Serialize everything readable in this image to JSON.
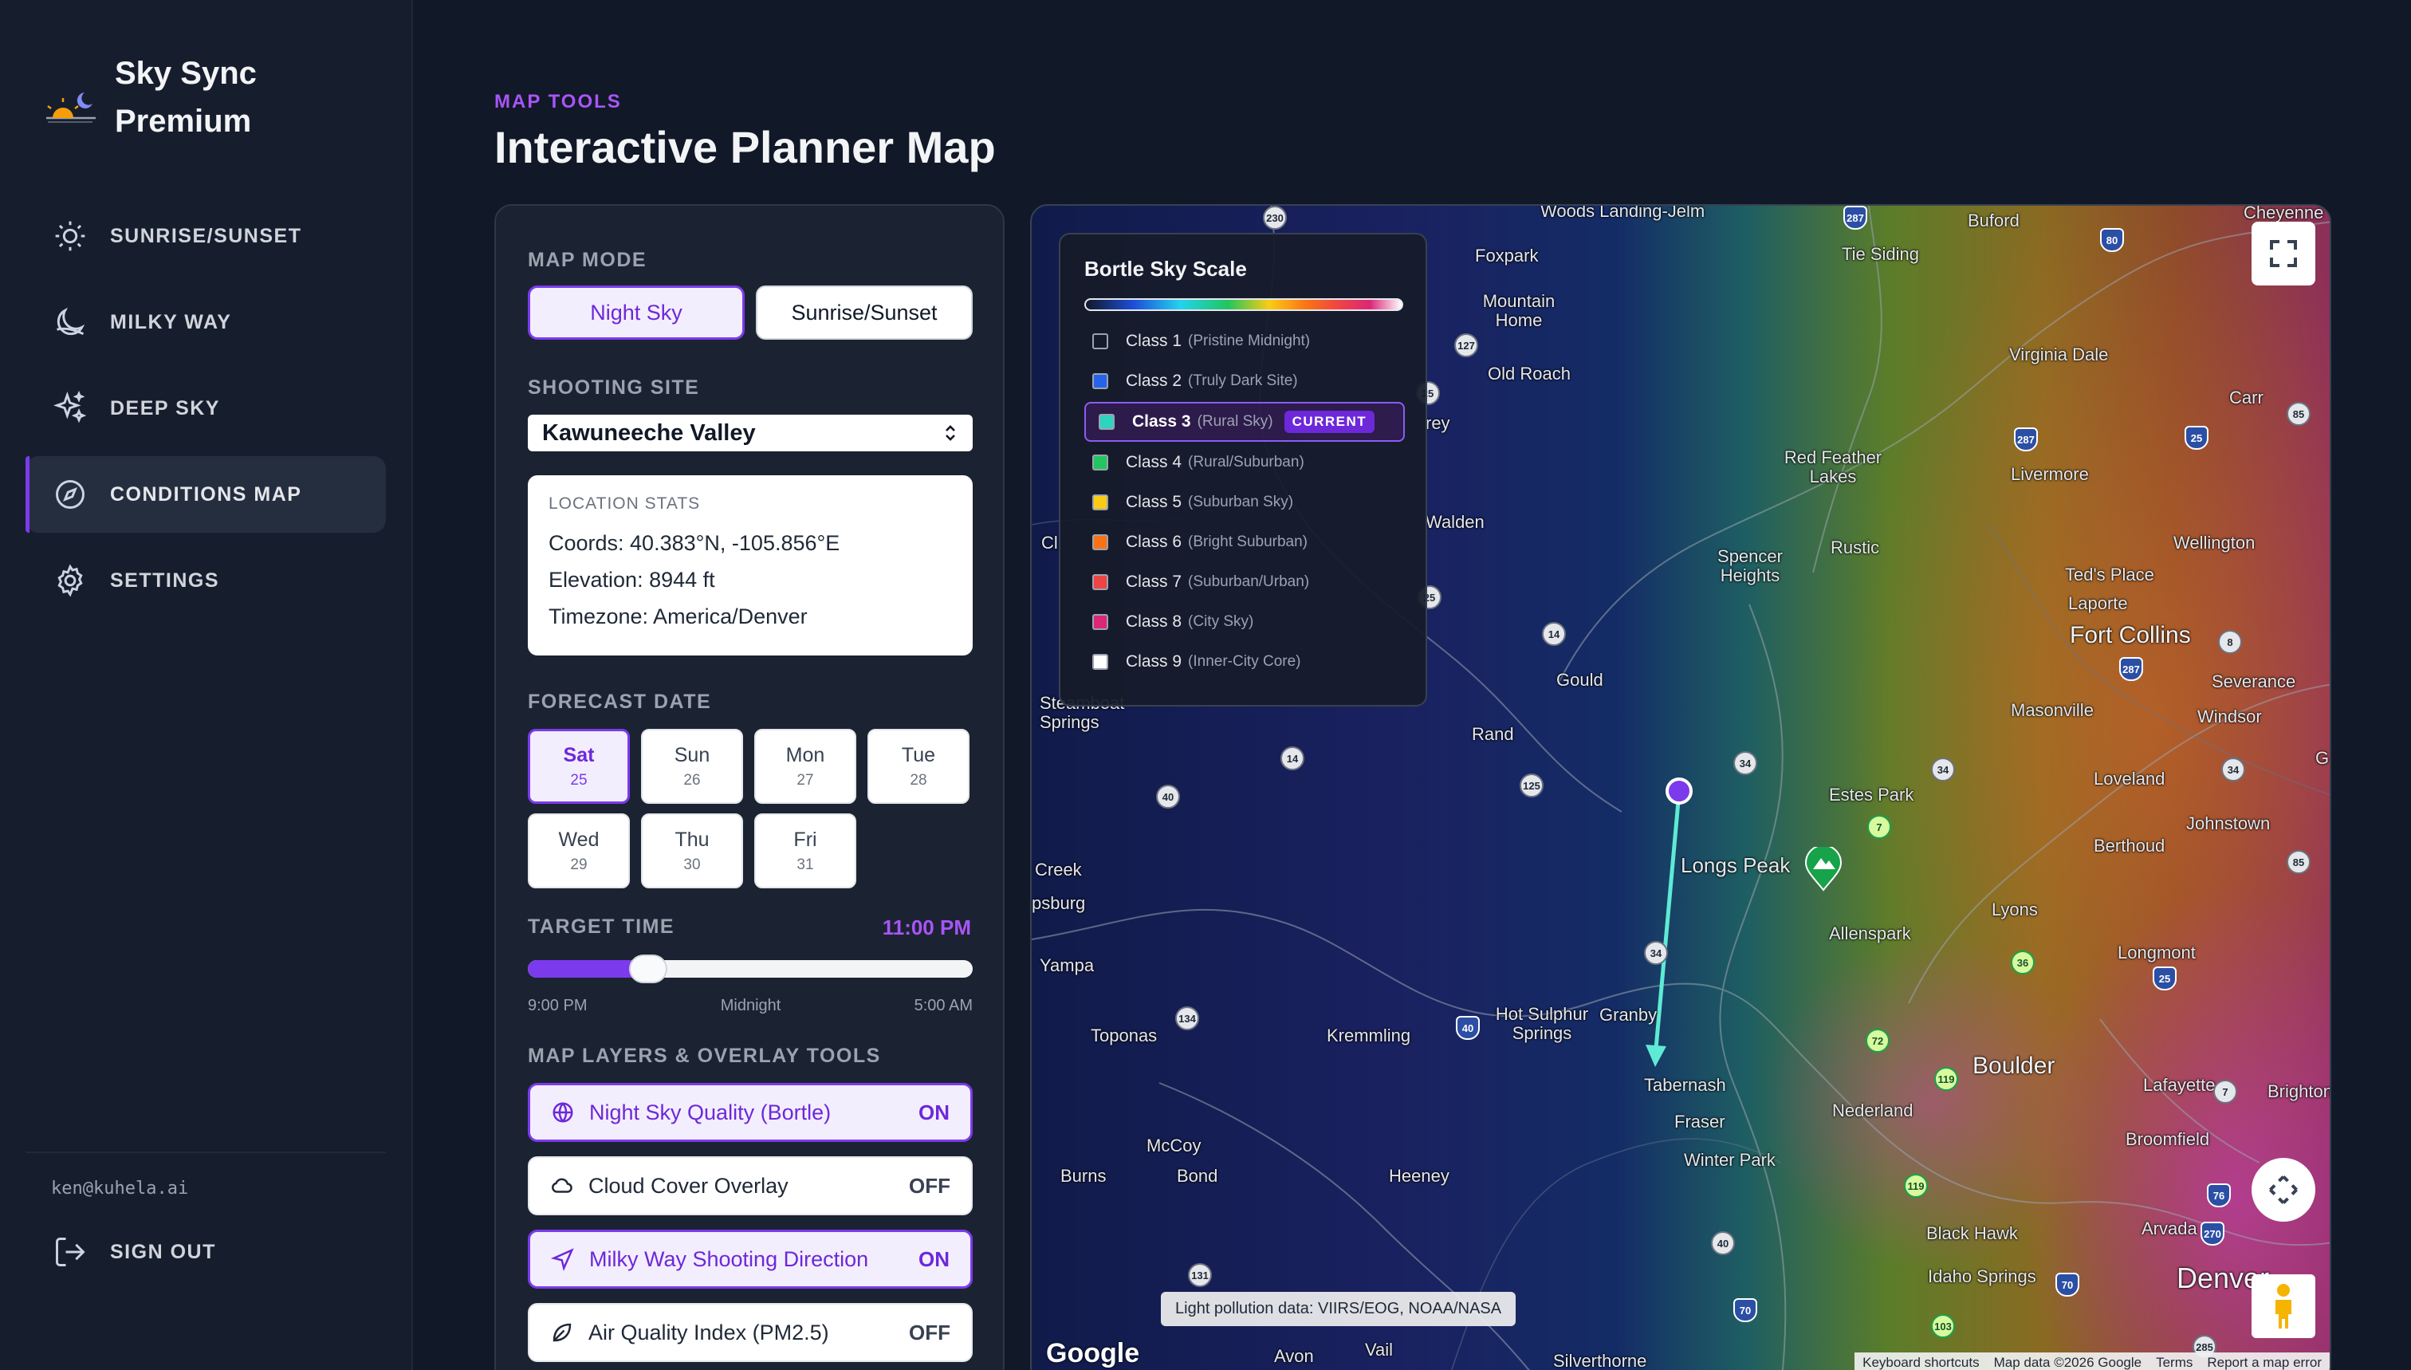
{
  "app": {
    "name": "Sky Sync Premium"
  },
  "sidebar": {
    "items": [
      {
        "label": "SUNRISE/SUNSET",
        "icon": "sun-icon"
      },
      {
        "label": "MILKY WAY",
        "icon": "moon-icon"
      },
      {
        "label": "DEEP SKY",
        "icon": "sparkles-icon"
      },
      {
        "label": "CONDITIONS MAP",
        "icon": "compass-icon",
        "active": true
      },
      {
        "label": "SETTINGS",
        "icon": "gear-icon"
      }
    ],
    "user_email": "ken@kuhela.ai",
    "sign_out": "SIGN OUT"
  },
  "header": {
    "eyebrow": "MAP TOOLS",
    "title": "Interactive Planner Map"
  },
  "panel": {
    "map_mode": {
      "label": "MAP MODE",
      "options": [
        "Night Sky",
        "Sunrise/Sunset"
      ],
      "selected": "Night Sky"
    },
    "shooting_site": {
      "label": "SHOOTING SITE",
      "value": "Kawuneeche Valley"
    },
    "location_stats": {
      "caption": "LOCATION STATS",
      "coords": "Coords: 40.383°N, -105.856°E",
      "elevation": "Elevation: 8944 ft",
      "timezone": "Timezone: America/Denver"
    },
    "forecast": {
      "label": "FORECAST DATE",
      "days": [
        {
          "name": "Sat",
          "date": "25",
          "active": true
        },
        {
          "name": "Sun",
          "date": "26"
        },
        {
          "name": "Mon",
          "date": "27"
        },
        {
          "name": "Tue",
          "date": "28"
        },
        {
          "name": "Wed",
          "date": "29"
        },
        {
          "name": "Thu",
          "date": "30"
        },
        {
          "name": "Fri",
          "date": "31"
        }
      ]
    },
    "target_time": {
      "label": "TARGET TIME",
      "value": "11:00 PM",
      "slider_fraction": 0.27,
      "ticks": [
        "9:00 PM",
        "Midnight",
        "5:00 AM"
      ]
    },
    "layers": {
      "label": "MAP LAYERS & OVERLAY TOOLS",
      "items": [
        {
          "label": "Night Sky Quality (Bortle)",
          "state": "ON",
          "icon": "globe-icon"
        },
        {
          "label": "Cloud Cover Overlay",
          "state": "OFF",
          "icon": "cloud-icon"
        },
        {
          "label": "Milky Way Shooting Direction",
          "state": "ON",
          "icon": "navigation-arrow-icon"
        },
        {
          "label": "Air Quality Index (PM2.5)",
          "state": "OFF",
          "icon": "leaf-icon"
        }
      ]
    }
  },
  "map": {
    "legend": {
      "title": "Bortle Sky Scale",
      "current_badge": "CURRENT",
      "classes": [
        {
          "label": "Class 1",
          "desc": "(Pristine Midnight)",
          "color": "#111827"
        },
        {
          "label": "Class 2",
          "desc": "(Truly Dark Site)",
          "color": "#2563eb"
        },
        {
          "label": "Class 3",
          "desc": "(Rural Sky)",
          "color": "#2dd4bf",
          "current": true
        },
        {
          "label": "Class 4",
          "desc": "(Rural/Suburban)",
          "color": "#22c55e"
        },
        {
          "label": "Class 5",
          "desc": "(Suburban Sky)",
          "color": "#facc15"
        },
        {
          "label": "Class 6",
          "desc": "(Bright Suburban)",
          "color": "#f97316"
        },
        {
          "label": "Class 7",
          "desc": "(Suburban/Urban)",
          "color": "#ef4444"
        },
        {
          "label": "Class 8",
          "desc": "(City Sky)",
          "color": "#db2777"
        },
        {
          "label": "Class 9",
          "desc": "(Inner-City Core)",
          "color": "#ffffff"
        }
      ]
    },
    "places": [
      "Woods Landing-Jelm",
      "Foxpark",
      "Mountain Home",
      "Old Roach",
      "Tie Siding",
      "Buford",
      "Cheyenne",
      "Virginia Dale",
      "Carr",
      "Red Feather Lakes",
      "Livermore",
      "Wellington",
      "Spencer Heights",
      "Rustic",
      "Ted's Place",
      "Laporte",
      "Fort Collins",
      "Severance",
      "Windsor",
      "Gould",
      "Rand",
      "Masonville",
      "Loveland",
      "Estes Park",
      "Johnstown",
      "Berthoud",
      "Longs Peak",
      "Allenspark",
      "Lyons",
      "Longmont",
      "Hot Sulphur Springs",
      "Granby",
      "Tabernash",
      "Fraser",
      "Winter Park",
      "Nederland",
      "Boulder",
      "Lafayette",
      "Broomfield",
      "Brighton",
      "Kremmling",
      "Toponas",
      "McCoy",
      "Bond",
      "Burns",
      "Heeney",
      "Black Hawk",
      "Idaho Springs",
      "Arvada",
      "Denver",
      "Yampa",
      "Steamboat Springs",
      "Creek",
      "Walden",
      "Avon",
      "Vail",
      "Silverthorne",
      "Cl",
      "rey",
      "psburg",
      "G"
    ],
    "shields": [
      "230",
      "287",
      "80",
      "127",
      "25",
      "85",
      "287",
      "25",
      "25",
      "14",
      "287",
      "14",
      "40",
      "125",
      "34",
      "34",
      "7",
      "34",
      "85",
      "36",
      "25",
      "134",
      "40",
      "72",
      "119",
      "7",
      "119",
      "76",
      "270",
      "40",
      "131",
      "70",
      "70",
      "103",
      "285",
      "8",
      "34"
    ],
    "attribution": "Light pollution data: VIIRS/EOG, NOAA/NASA",
    "google_logo": "Google",
    "footer": [
      "Keyboard shortcuts",
      "Map data ©2026 Google",
      "Terms",
      "Report a map error"
    ]
  }
}
